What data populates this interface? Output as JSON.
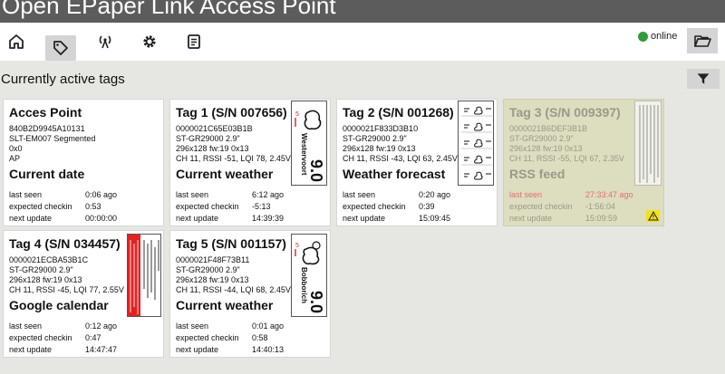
{
  "app": {
    "title": "Open EPaper Link Access Point"
  },
  "toolbar": {
    "buttons": [
      {
        "name": "home-button",
        "icon": "home-icon"
      },
      {
        "name": "tags-button",
        "icon": "tag-icon",
        "active": true
      },
      {
        "name": "access-point-button",
        "icon": "antenna-icon"
      },
      {
        "name": "settings-button",
        "icon": "gear-icon"
      },
      {
        "name": "log-button",
        "icon": "document-icon"
      }
    ],
    "status_text": "online",
    "status_color": "#2e9d3a",
    "folder_icon": "folder-open-icon"
  },
  "main": {
    "heading": "Currently active tags",
    "filter_icon": "filter-icon"
  },
  "labels": {
    "last_seen": "last seen",
    "expected_checkin": "expected checkin",
    "next_update": "next update"
  },
  "tags": [
    {
      "name": "Acces Point",
      "info": [
        "840B2D9945A10131",
        "SLT-EM007 Segmented",
        "0x0",
        "AP"
      ],
      "content": "Current date",
      "last_seen": "0:06 ago",
      "expected_checkin": "0:53",
      "next_update": "00:00:00"
    },
    {
      "name": "Tag 1 (S/N 007656)",
      "info": [
        "0000021C65E03B1B",
        "ST-GR29000 2.9\"",
        "296x128 fw:19 0x13",
        "CH 11, RSSI -51, LQI 78, 2.45V"
      ],
      "content": "Current weather",
      "last_seen": "6:12 ago",
      "expected_checkin": "-5:13",
      "next_update": "14:39:39",
      "preview": {
        "city": "Westervoort",
        "temp": "9.0",
        "wind": "5"
      }
    },
    {
      "name": "Tag 2 (S/N 001268)",
      "info": [
        "0000021F833D3B10",
        "ST-GR29000 2.9\"",
        "296x128 fw:19 0x13",
        "CH 11, RSSI -43, LQI 63, 2.45V"
      ],
      "content": "Weather forecast",
      "last_seen": "0:20 ago",
      "expected_checkin": "0:39",
      "next_update": "15:09:45"
    },
    {
      "name": "Tag 3 (S/N 009397)",
      "info": [
        "0000021B6DEF3B1B",
        "ST-GR29000 2.9\"",
        "296x128 fw:19 0x13",
        "CH 11, RSSI -55, LQI 67, 2.35V"
      ],
      "content": "RSS feed",
      "last_seen": "27:33:47 ago",
      "expected_checkin": "-1:56:04",
      "next_update": "15:09:59",
      "warning_icon": "warning-icon"
    },
    {
      "name": "Tag 4 (S/N 034457)",
      "info": [
        "0000021ECBA53B1C",
        "ST-GR29000 2.9\"",
        "296x128 fw:19 0x13",
        "CH 11, RSSI -45, LQI 77, 2.55V"
      ],
      "content": "Google calendar",
      "last_seen": "0:12 ago",
      "expected_checkin": "0:47",
      "next_update": "14:47:47"
    },
    {
      "name": "Tag 5 (S/N 001157)",
      "info": [
        "0000021F48F73B11",
        "ST-GR29000 2.9\"",
        "296x128 fw:19 0x13",
        "CH 11, RSSI -44, LQI 68, 2.45V"
      ],
      "content": "Current weather",
      "last_seen": "0:01 ago",
      "expected_checkin": "0:58",
      "next_update": "14:40:13",
      "preview": {
        "city": "Bobborich",
        "temp": "9.0",
        "wind": "5"
      }
    }
  ]
}
